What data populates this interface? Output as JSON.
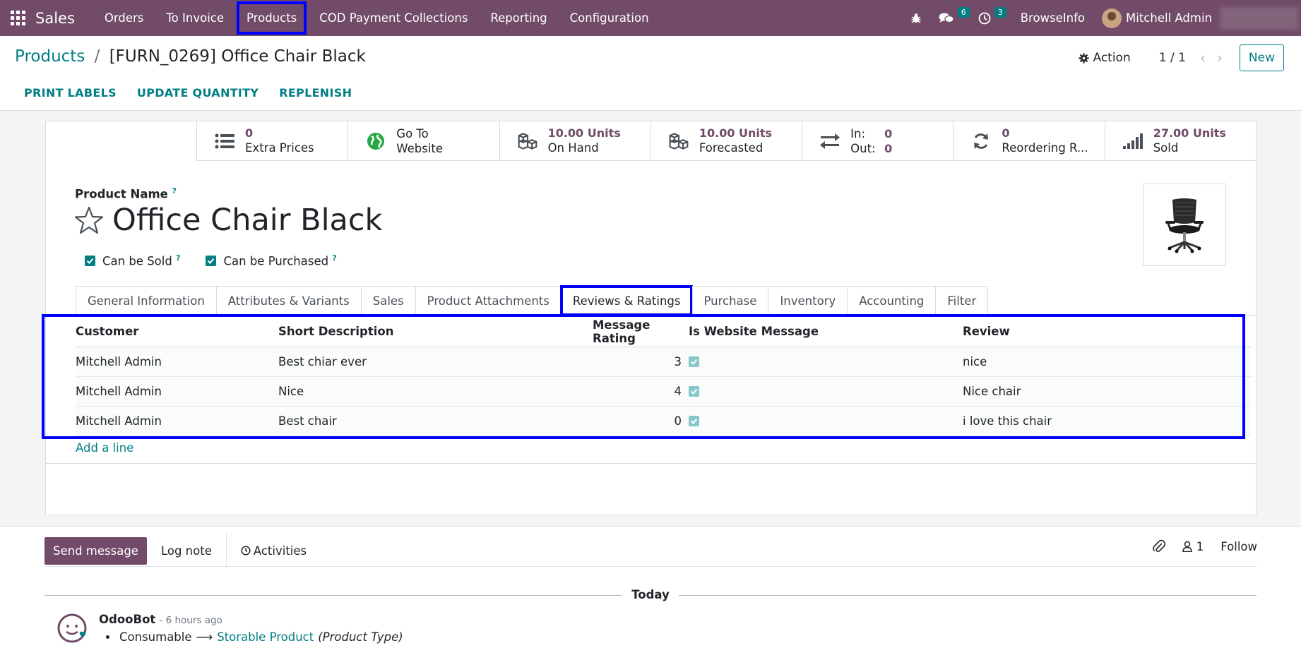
{
  "navbar": {
    "app_name": "Sales",
    "menus": [
      "Orders",
      "To Invoice",
      "Products",
      "COD Payment Collections",
      "Reporting",
      "Configuration"
    ],
    "messages_badge": "6",
    "activities_badge": "3",
    "company": "BrowseInfo",
    "user": "Mitchell Admin"
  },
  "control": {
    "breadcrumb_root": "Products",
    "breadcrumb_sep": "/",
    "breadcrumb_current": "[FURN_0269] Office Chair Black",
    "action_label": "Action",
    "pager": "1 / 1",
    "new_label": "New",
    "buttons": [
      "PRINT LABELS",
      "UPDATE QUANTITY",
      "REPLENISH"
    ]
  },
  "stats": {
    "extra_prices": {
      "value": "0",
      "label": "Extra Prices"
    },
    "website": {
      "line1": "Go To",
      "line2": "Website"
    },
    "on_hand": {
      "value": "10.00 Units",
      "label": "On Hand"
    },
    "forecasted": {
      "value": "10.00 Units",
      "label": "Forecasted"
    },
    "in_out": {
      "in_label": "In:",
      "in_value": "0",
      "out_label": "Out:",
      "out_value": "0"
    },
    "reordering": {
      "value": "0",
      "label": "Reordering R..."
    },
    "sold": {
      "value": "27.00 Units",
      "label": "Sold"
    }
  },
  "product": {
    "name_label": "Product Name",
    "help_mark": "?",
    "name": "Office Chair Black",
    "can_be_sold": "Can be Sold",
    "can_be_purchased": "Can be Purchased"
  },
  "tabs": [
    "General Information",
    "Attributes & Variants",
    "Sales",
    "Product Attachments",
    "Reviews & Ratings",
    "Purchase",
    "Inventory",
    "Accounting",
    "Filter"
  ],
  "reviews": {
    "headers": {
      "customer": "Customer",
      "short_description": "Short Description",
      "rating": "Message Rating",
      "website": "Is Website Message",
      "review": "Review"
    },
    "rows": [
      {
        "customer": "Mitchell Admin",
        "short_description": "Best chiar ever",
        "rating": "3",
        "review": "nice"
      },
      {
        "customer": "Mitchell Admin",
        "short_description": "Nice",
        "rating": "4",
        "review": "Nice chair"
      },
      {
        "customer": "Mitchell Admin",
        "short_description": "Best chair",
        "rating": "0",
        "review": "i love this chair"
      }
    ],
    "add_line": "Add a line"
  },
  "chatter": {
    "send_message": "Send message",
    "log_note": "Log note",
    "activities": "Activities",
    "followers_count": "1",
    "follow": "Follow",
    "today": "Today",
    "message": {
      "author": "OdooBot",
      "time": "- 6 hours ago",
      "old_value": "Consumable",
      "arrow": "⟶",
      "new_value": "Storable Product",
      "field": "(Product Type)"
    }
  },
  "colors": {
    "brand": "#714b67",
    "accent": "#017e84",
    "highlight": "#0000ff"
  }
}
